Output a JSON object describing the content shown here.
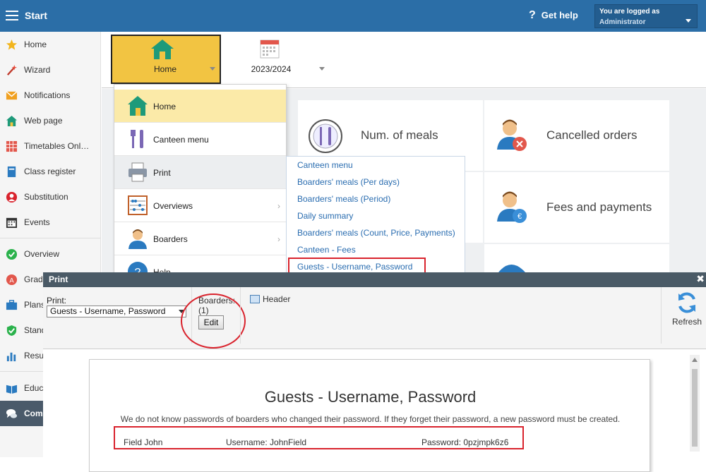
{
  "topbar": {
    "start_label": "Start",
    "help_label": "Get help",
    "login_line1": "You are logged as",
    "login_line2": "Administrator"
  },
  "sidebar": {
    "items": [
      {
        "label": "Home",
        "icon": "star-icon"
      },
      {
        "label": "Wizard",
        "icon": "wand-icon"
      },
      {
        "label": "Notifications",
        "icon": "envelope-icon"
      },
      {
        "label": "Web page",
        "icon": "house-icon"
      },
      {
        "label": "Timetables Onl…",
        "icon": "timetable-icon"
      },
      {
        "label": "Class register",
        "icon": "book-icon"
      },
      {
        "label": "Substitution",
        "icon": "substitution-icon"
      },
      {
        "label": "Events",
        "icon": "calendar-icon"
      },
      {
        "label": "Overview",
        "icon": "check-circle-icon"
      },
      {
        "label": "Grad",
        "icon": "grades-icon"
      },
      {
        "label": "Plans",
        "icon": "briefcase-icon"
      },
      {
        "label": "Stand",
        "icon": "shield-check-icon"
      },
      {
        "label": "Resu",
        "icon": "chart-icon"
      },
      {
        "label": "Educ",
        "icon": "open-book-icon"
      },
      {
        "label": "Com",
        "icon": "chat-icon"
      }
    ]
  },
  "ribbon": {
    "home_label": "Home",
    "year_label": "2023/2024"
  },
  "tiles": {
    "num_meals": "Num. of meals",
    "cancelled_orders": "Cancelled orders",
    "fees_payments": "Fees and payments"
  },
  "menu": {
    "items": [
      {
        "label": "Home"
      },
      {
        "label": "Canteen menu"
      },
      {
        "label": "Print"
      },
      {
        "label": "Overviews",
        "arrow": "›"
      },
      {
        "label": "Boarders",
        "arrow": "›"
      },
      {
        "label": "Help"
      }
    ]
  },
  "submenu": {
    "items": [
      "Canteen menu",
      "Boarders' meals (Per days)",
      "Boarders' meals (Period)",
      "Daily summary",
      "Boarders' meals (Count, Price, Payments)",
      "Canteen - Fees",
      "Guests - Username, Password"
    ]
  },
  "dialog": {
    "title": "Print",
    "close": "✖",
    "print_label": "Print:",
    "print_value": "Guests - Username, Password",
    "boarders_label": "Boarders:",
    "boarders_count": "(1)",
    "edit_label": "Edit",
    "header_label": "Header",
    "refresh_label": "Refresh"
  },
  "preview": {
    "title": "Guests - Username, Password",
    "note": "We do not know passwords of boarders who changed their password. If they forget their password, a new password must be created.",
    "rows": [
      {
        "name": "Field John",
        "username": "Username: JohnField",
        "password": "Password: 0pzjmpk6z6"
      }
    ]
  },
  "colors": {
    "topbar": "#2b6ea7",
    "ribbon_active": "#f2c442",
    "menu_highlight": "#fbeaa8",
    "link": "#2a6db0",
    "annotation_red": "#d9232d",
    "dialog_title": "#4a5a66"
  }
}
